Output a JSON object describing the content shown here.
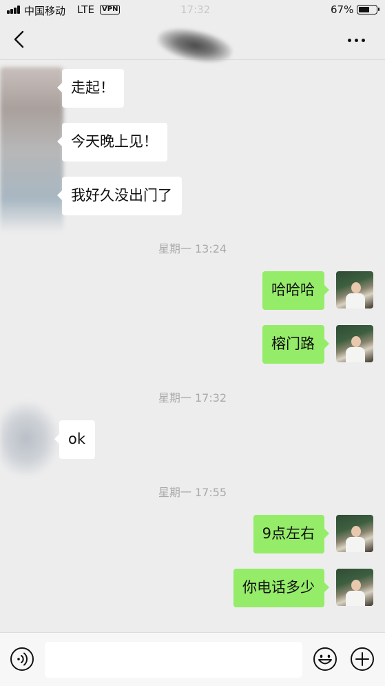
{
  "status_bar": {
    "carrier": "中国移动",
    "network": "LTE",
    "vpn": "VPN",
    "time": "17:32",
    "battery_percent": "67%",
    "battery_level": 0.67
  },
  "nav": {
    "back_icon": "chevron-left-icon",
    "more_icon": "ellipsis-icon"
  },
  "messages": [
    {
      "sender": "contact",
      "text": "走起！"
    },
    {
      "sender": "contact",
      "text": "今天晚上见！"
    },
    {
      "sender": "contact",
      "text": "我好久没出门了"
    },
    {
      "sender": "timestamp",
      "text": "星期一 13:24"
    },
    {
      "sender": "me",
      "text": "哈哈哈"
    },
    {
      "sender": "me",
      "text": "榕门路"
    },
    {
      "sender": "timestamp",
      "text": "星期一 17:32"
    },
    {
      "sender": "contact",
      "text": "ok"
    },
    {
      "sender": "timestamp",
      "text": "星期一 17:55"
    },
    {
      "sender": "me",
      "text": "9点左右"
    },
    {
      "sender": "me",
      "text": "你电话多少"
    }
  ],
  "input_bar": {
    "voice_icon": "voice-icon",
    "text_value": "",
    "emoji_icon": "emoji-icon",
    "plus_icon": "plus-icon"
  },
  "colors": {
    "background": "#ededed",
    "outgoing_bubble": "#95ec69",
    "incoming_bubble": "#ffffff",
    "timestamp_text": "#a9a9a9"
  }
}
